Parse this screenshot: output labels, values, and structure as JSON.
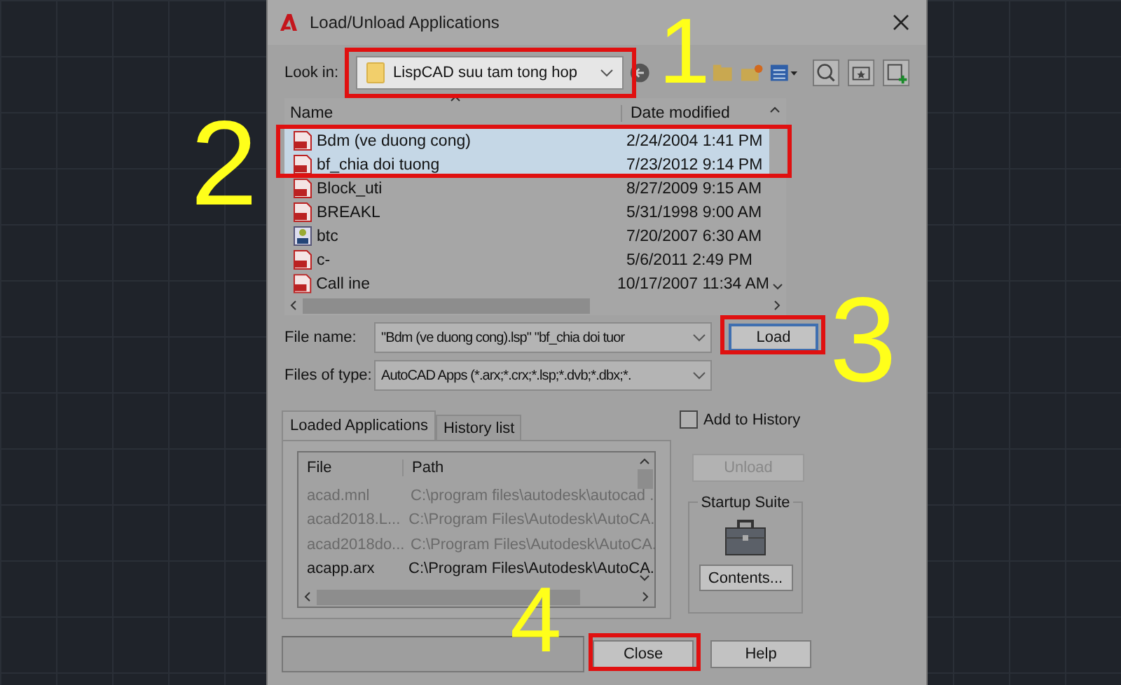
{
  "window": {
    "title": "Load/Unload Applications"
  },
  "look_in": {
    "label": "Look in:",
    "value": "LispCAD suu tam tong hop"
  },
  "file_list": {
    "columns": [
      "Name",
      "Date modified"
    ],
    "rows": [
      {
        "name": "Bdm (ve duong cong)",
        "date": "2/24/2004 1:41 PM",
        "kind": "lsp",
        "selected": true
      },
      {
        "name": "bf_chia doi tuong",
        "date": "7/23/2012 9:14 PM",
        "kind": "lsp",
        "selected": true
      },
      {
        "name": "Block_uti",
        "date": "8/27/2009 9:15 AM",
        "kind": "lsp",
        "selected": false
      },
      {
        "name": "BREAKL",
        "date": "5/31/1998 9:00 AM",
        "kind": "lsp",
        "selected": false
      },
      {
        "name": "btc",
        "date": "7/20/2007 6:30 AM",
        "kind": "dvb",
        "selected": false
      },
      {
        "name": "c-",
        "date": "5/6/2011 2:49 PM",
        "kind": "lsp",
        "selected": false
      },
      {
        "name": "Call ine",
        "date": "10/17/2007 11:34 AM",
        "kind": "lsp",
        "selected": false
      }
    ]
  },
  "file_name": {
    "label": "File name:",
    "value": "\"Bdm (ve duong cong).lsp\" \"bf_chia doi tuor"
  },
  "files_of_type": {
    "label": "Files of type:",
    "value": "AutoCAD Apps (*.arx;*.crx;*.lsp;*.dvb;*.dbx;*."
  },
  "load_button": {
    "label": "Load"
  },
  "tabs": [
    {
      "label": "Loaded Applications",
      "selected": true
    },
    {
      "label": "History list",
      "selected": false
    }
  ],
  "loaded_apps": {
    "columns": [
      "File",
      "Path"
    ],
    "rows": [
      {
        "file": "acad.mnl",
        "path": "C:\\program files\\autodesk\\autocad .",
        "disabled": true
      },
      {
        "file": "acad2018.L...",
        "path": "C:\\Program Files\\Autodesk\\AutoCA.",
        "disabled": true
      },
      {
        "file": "acad2018do...",
        "path": "C:\\Program Files\\Autodesk\\AutoCA.",
        "disabled": true
      },
      {
        "file": "acapp.arx",
        "path": "C:\\Program Files\\Autodesk\\AutoCA.",
        "disabled": false
      }
    ]
  },
  "add_to_history": {
    "label": "Add to History",
    "checked": false
  },
  "unload_button": {
    "label": "Unload",
    "disabled": true
  },
  "startup_suite": {
    "title": "Startup Suite",
    "button": "Contents..."
  },
  "buttons": [
    "Close",
    "Help"
  ],
  "annotations": [
    {
      "label": "1"
    },
    {
      "label": "2"
    },
    {
      "label": "3"
    },
    {
      "label": "4"
    }
  ]
}
